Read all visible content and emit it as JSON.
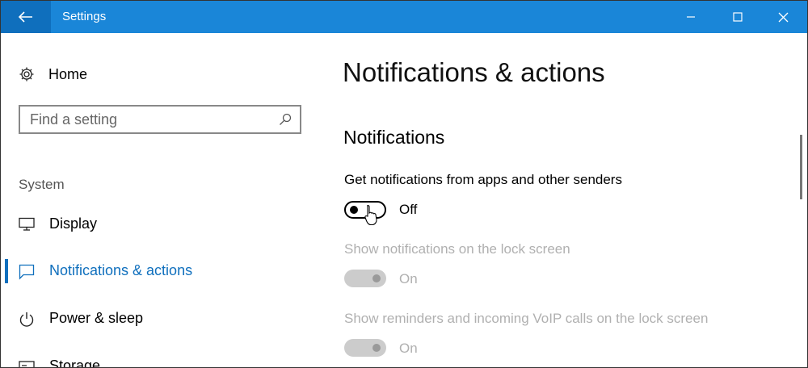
{
  "window": {
    "title": "Settings"
  },
  "sidebar": {
    "home_label": "Home",
    "search_placeholder": "Find a setting",
    "section_label": "System",
    "items": [
      {
        "label": "Display",
        "icon": "monitor-icon"
      },
      {
        "label": "Notifications & actions",
        "icon": "message-icon",
        "active": true
      },
      {
        "label": "Power & sleep",
        "icon": "power-icon"
      },
      {
        "label": "Storage",
        "icon": "storage-icon"
      }
    ]
  },
  "main": {
    "page_title": "Notifications & actions",
    "section_title": "Notifications",
    "settings": [
      {
        "label": "Get notifications from apps and other senders",
        "state": "Off",
        "enabled": true
      },
      {
        "label": "Show notifications on the lock screen",
        "state": "On",
        "enabled": false
      },
      {
        "label": "Show reminders and incoming VoIP calls on the lock screen",
        "state": "On",
        "enabled": false
      }
    ]
  },
  "colors": {
    "titlebar": "#1a86d8",
    "back_button": "#0f6fbd",
    "accent": "#0f6fbd",
    "disabled_text": "#b0b0b0"
  }
}
